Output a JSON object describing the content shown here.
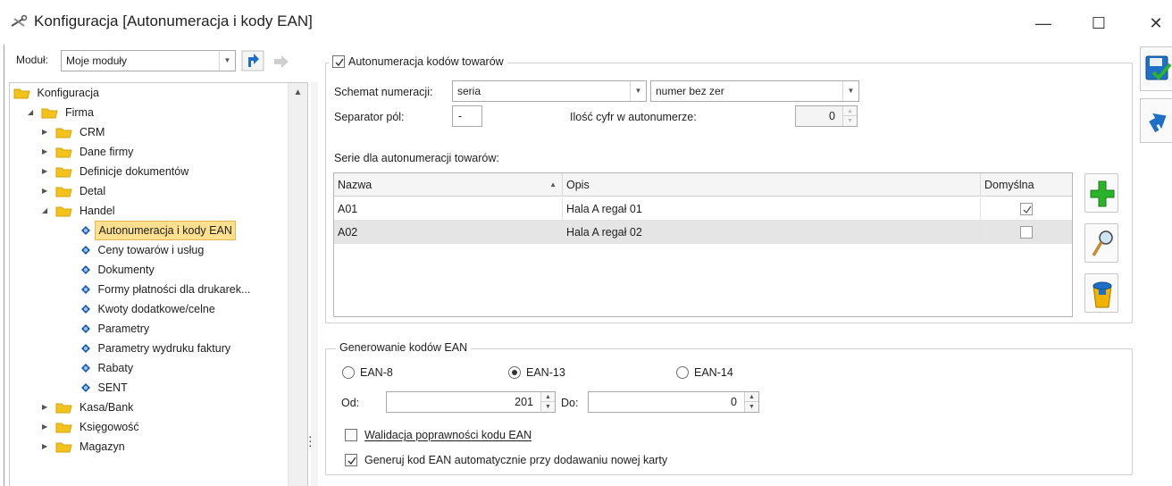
{
  "window": {
    "title": "Konfiguracja [Autonumeracja i kody EAN]",
    "minimize_glyph": "—",
    "maximize_glyph": "☐",
    "close_glyph": "✕"
  },
  "module": {
    "label": "Moduł:",
    "selected": "Moje moduły"
  },
  "tree": {
    "items": [
      {
        "label": "Konfiguracja",
        "level": 0,
        "type": "folder",
        "expanded": true
      },
      {
        "label": "Firma",
        "level": 1,
        "type": "folder",
        "expanded": true
      },
      {
        "label": "CRM",
        "level": 2,
        "type": "folder",
        "expanded": false
      },
      {
        "label": "Dane firmy",
        "level": 2,
        "type": "folder",
        "expanded": false
      },
      {
        "label": "Definicje dokumentów",
        "level": 2,
        "type": "folder",
        "expanded": false
      },
      {
        "label": "Detal",
        "level": 2,
        "type": "folder",
        "expanded": false
      },
      {
        "label": "Handel",
        "level": 2,
        "type": "folder",
        "expanded": true
      },
      {
        "label": "Autonumeracja i kody EAN",
        "level": 3,
        "type": "leaf",
        "selected": true
      },
      {
        "label": "Ceny towarów i usług",
        "level": 3,
        "type": "leaf"
      },
      {
        "label": "Dokumenty",
        "level": 3,
        "type": "leaf"
      },
      {
        "label": "Formy płatności dla drukarek...",
        "level": 3,
        "type": "leaf"
      },
      {
        "label": "Kwoty dodatkowe/celne",
        "level": 3,
        "type": "leaf"
      },
      {
        "label": "Parametry",
        "level": 3,
        "type": "leaf"
      },
      {
        "label": "Parametry wydruku faktury",
        "level": 3,
        "type": "leaf"
      },
      {
        "label": "Rabaty",
        "level": 3,
        "type": "leaf"
      },
      {
        "label": "SENT",
        "level": 3,
        "type": "leaf"
      },
      {
        "label": "Kasa/Bank",
        "level": 2,
        "type": "folder",
        "expanded": false
      },
      {
        "label": "Księgowość",
        "level": 2,
        "type": "folder",
        "expanded": false
      },
      {
        "label": "Magazyn",
        "level": 2,
        "type": "folder",
        "expanded": false
      }
    ]
  },
  "autonum": {
    "group_label": "Autonumeracja kodów towarów",
    "enabled": true,
    "schema_label": "Schemat numeracji:",
    "schema_value1": "seria",
    "schema_value2": "numer bez zer",
    "separator_label": "Separator pól:",
    "separator_value": "-",
    "digits_label": "Ilość cyfr w autonumerze:",
    "digits_value": "0",
    "series_label": "Serie dla autonumeracji towarów:",
    "columns": [
      "Nazwa",
      "Opis",
      "Domyślna"
    ],
    "rows": [
      {
        "nazwa": "A01",
        "opis": "Hala A regał 01",
        "domyslna": true
      },
      {
        "nazwa": "A02",
        "opis": "Hala A regał 02",
        "domyslna": false
      }
    ]
  },
  "ean": {
    "group_label": "Generowanie kodów EAN",
    "options": [
      "EAN-8",
      "EAN-13",
      "EAN-14"
    ],
    "selected": "EAN-13",
    "from_label": "Od:",
    "from_value": "201",
    "to_label": "Do:",
    "to_value": "0",
    "validate_label": "Walidacja poprawności kodu EAN",
    "validate_checked": false,
    "autogen_label": "Generuj kod EAN automatycznie przy dodawaniu nowej karty",
    "autogen_checked": true
  },
  "colors": {
    "selection": "#fde08f",
    "folder": "#f3c21b",
    "accent_green": "#2bb32b",
    "accent_blue": "#1d6fc8"
  }
}
